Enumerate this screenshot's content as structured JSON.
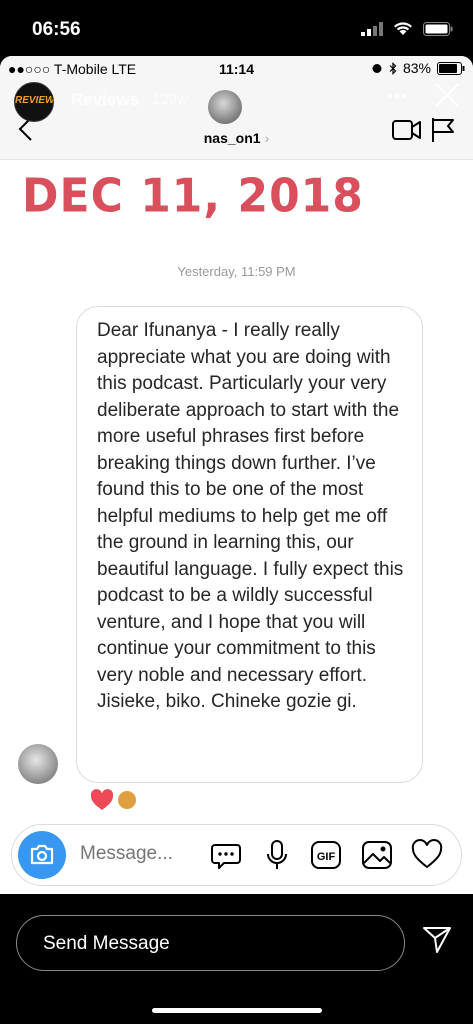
{
  "outer_status": {
    "time": "06:56"
  },
  "inner_status": {
    "carrier": "●●○○○ T-Mobile  LTE",
    "time": "11:14",
    "battery": "83%"
  },
  "story": {
    "account_name": "Reviews",
    "age": "129w",
    "avatar_text": "REVIEWS"
  },
  "dm": {
    "username": "nas_on1",
    "chevron": "›"
  },
  "date_stamp": "DEC 11, 2018",
  "message": {
    "timestamp": "Yesterday, 11:59 PM",
    "text": "Dear Ifunanya - I really really appreciate what you are doing with this podcast. Particularly your very deliberate approach to start with the more useful phrases first before breaking things down further. I’ve found this to be one of the most helpful mediums to help get me off the ground in learning this, our beautiful language. I fully expect this podcast to be a wildly successful venture, and I hope that you will continue your commitment to this very noble and necessary effort. Jisieke, biko. Chineke gozie gi."
  },
  "composer": {
    "placeholder": "Message..."
  },
  "bottom_bar": {
    "send_label": "Send Message"
  },
  "colors": {
    "accent": "#3897f0",
    "date_stamp": "#d94f5c",
    "heart": "#ed4956"
  },
  "icons": [
    "signal-icon",
    "wifi-icon",
    "battery-icon",
    "back-icon",
    "video-call-icon",
    "flag-icon",
    "more-icon",
    "close-icon",
    "camera-icon",
    "sticker-icon",
    "microphone-icon",
    "gif-icon",
    "gallery-icon",
    "heart-icon",
    "send-icon"
  ]
}
